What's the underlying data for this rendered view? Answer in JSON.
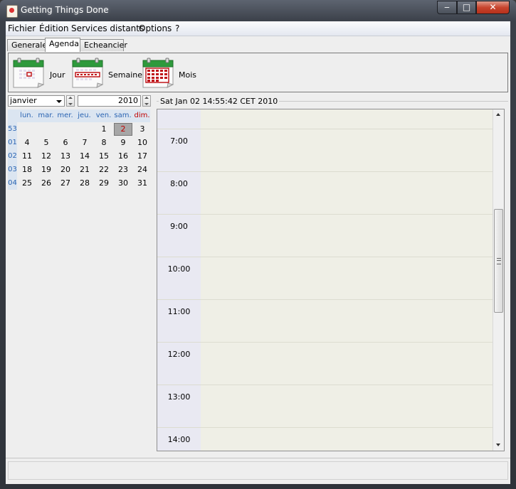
{
  "window": {
    "title": "Getting Things Done"
  },
  "menu": [
    "Fichier",
    "Édition",
    "Services distants",
    "Options",
    "?"
  ],
  "tabs": [
    {
      "label": "Generale",
      "active": false
    },
    {
      "label": "Agenda",
      "active": true
    },
    {
      "label": "Echeancier",
      "active": false
    }
  ],
  "toolbar": {
    "jour_label": "Jour",
    "semaine_label": "Semaine",
    "mois_label": "Mois"
  },
  "minicalendar": {
    "month": "janvier",
    "year": "2010",
    "day_headers": [
      "lun.",
      "mar.",
      "mer.",
      "jeu.",
      "ven.",
      "sam.",
      "dim."
    ],
    "week_numbers": [
      "53",
      "01",
      "02",
      "03",
      "04"
    ],
    "weeks": [
      [
        "",
        "",
        "",
        "",
        "1",
        "2",
        "3"
      ],
      [
        "4",
        "5",
        "6",
        "7",
        "8",
        "9",
        "10"
      ],
      [
        "11",
        "12",
        "13",
        "14",
        "15",
        "16",
        "17"
      ],
      [
        "18",
        "19",
        "20",
        "21",
        "22",
        "23",
        "24"
      ],
      [
        "25",
        "26",
        "27",
        "28",
        "29",
        "30",
        "31"
      ]
    ],
    "selected_day": "2"
  },
  "dayview": {
    "date_header": "Sat Jan 02 14:55:42 CET 2010",
    "hours": [
      "7:00",
      "8:00",
      "9:00",
      "10:00",
      "11:00",
      "12:00",
      "13:00",
      "14:00"
    ]
  },
  "colors": {
    "accent": "#2a64b2",
    "sunday": "#c00000",
    "event_bg": "#efefe6",
    "gutter_bg": "#e9e9f2"
  }
}
